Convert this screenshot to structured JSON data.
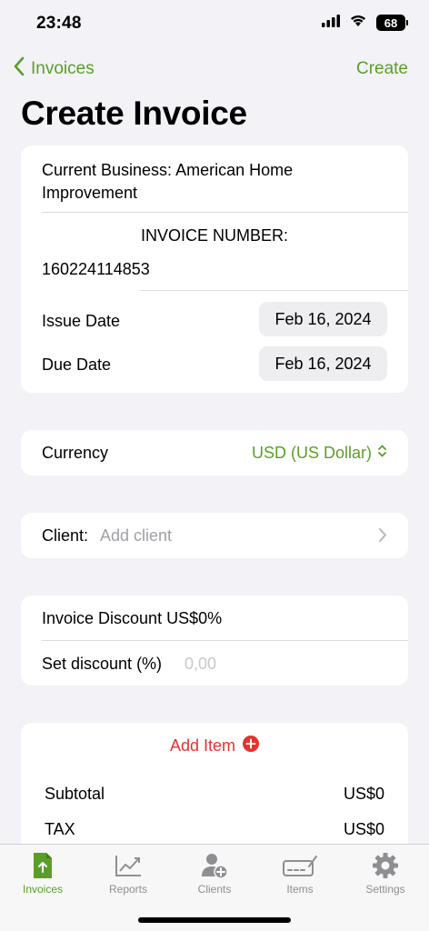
{
  "status": {
    "time": "23:48",
    "battery": "68"
  },
  "nav": {
    "back_label": "Invoices",
    "create_label": "Create"
  },
  "page_title": "Create Invoice",
  "business": {
    "line1": "Current Business: American Home",
    "line2": "Improvement"
  },
  "invoice": {
    "number_label": "INVOICE NUMBER:",
    "number_value": "160224114853"
  },
  "dates": {
    "issue_label": "Issue Date",
    "issue_value": "Feb 16, 2024",
    "due_label": "Due Date",
    "due_value": "Feb 16, 2024"
  },
  "currency": {
    "label": "Currency",
    "value": "USD (US Dollar)"
  },
  "client": {
    "label": "Client:",
    "placeholder": "Add client"
  },
  "discount": {
    "title": "Invoice Discount US$0%",
    "set_label": "Set discount (%)",
    "placeholder": "0,00"
  },
  "items": {
    "add_label": "Add Item",
    "subtotal_label": "Subtotal",
    "subtotal_value": "US$0",
    "tax_label": "TAX",
    "tax_value": "US$0"
  },
  "tabs": [
    {
      "label": "Invoices",
      "icon": "invoice-icon",
      "active": true
    },
    {
      "label": "Reports",
      "icon": "chart-icon",
      "active": false
    },
    {
      "label": "Clients",
      "icon": "add-person-icon",
      "active": false
    },
    {
      "label": "Items",
      "icon": "items-icon",
      "active": false
    },
    {
      "label": "Settings",
      "icon": "gear-icon",
      "active": false
    }
  ],
  "colors": {
    "accent": "#5a9e27",
    "add_item": "#e5312f",
    "background": "#f2f2f7"
  }
}
